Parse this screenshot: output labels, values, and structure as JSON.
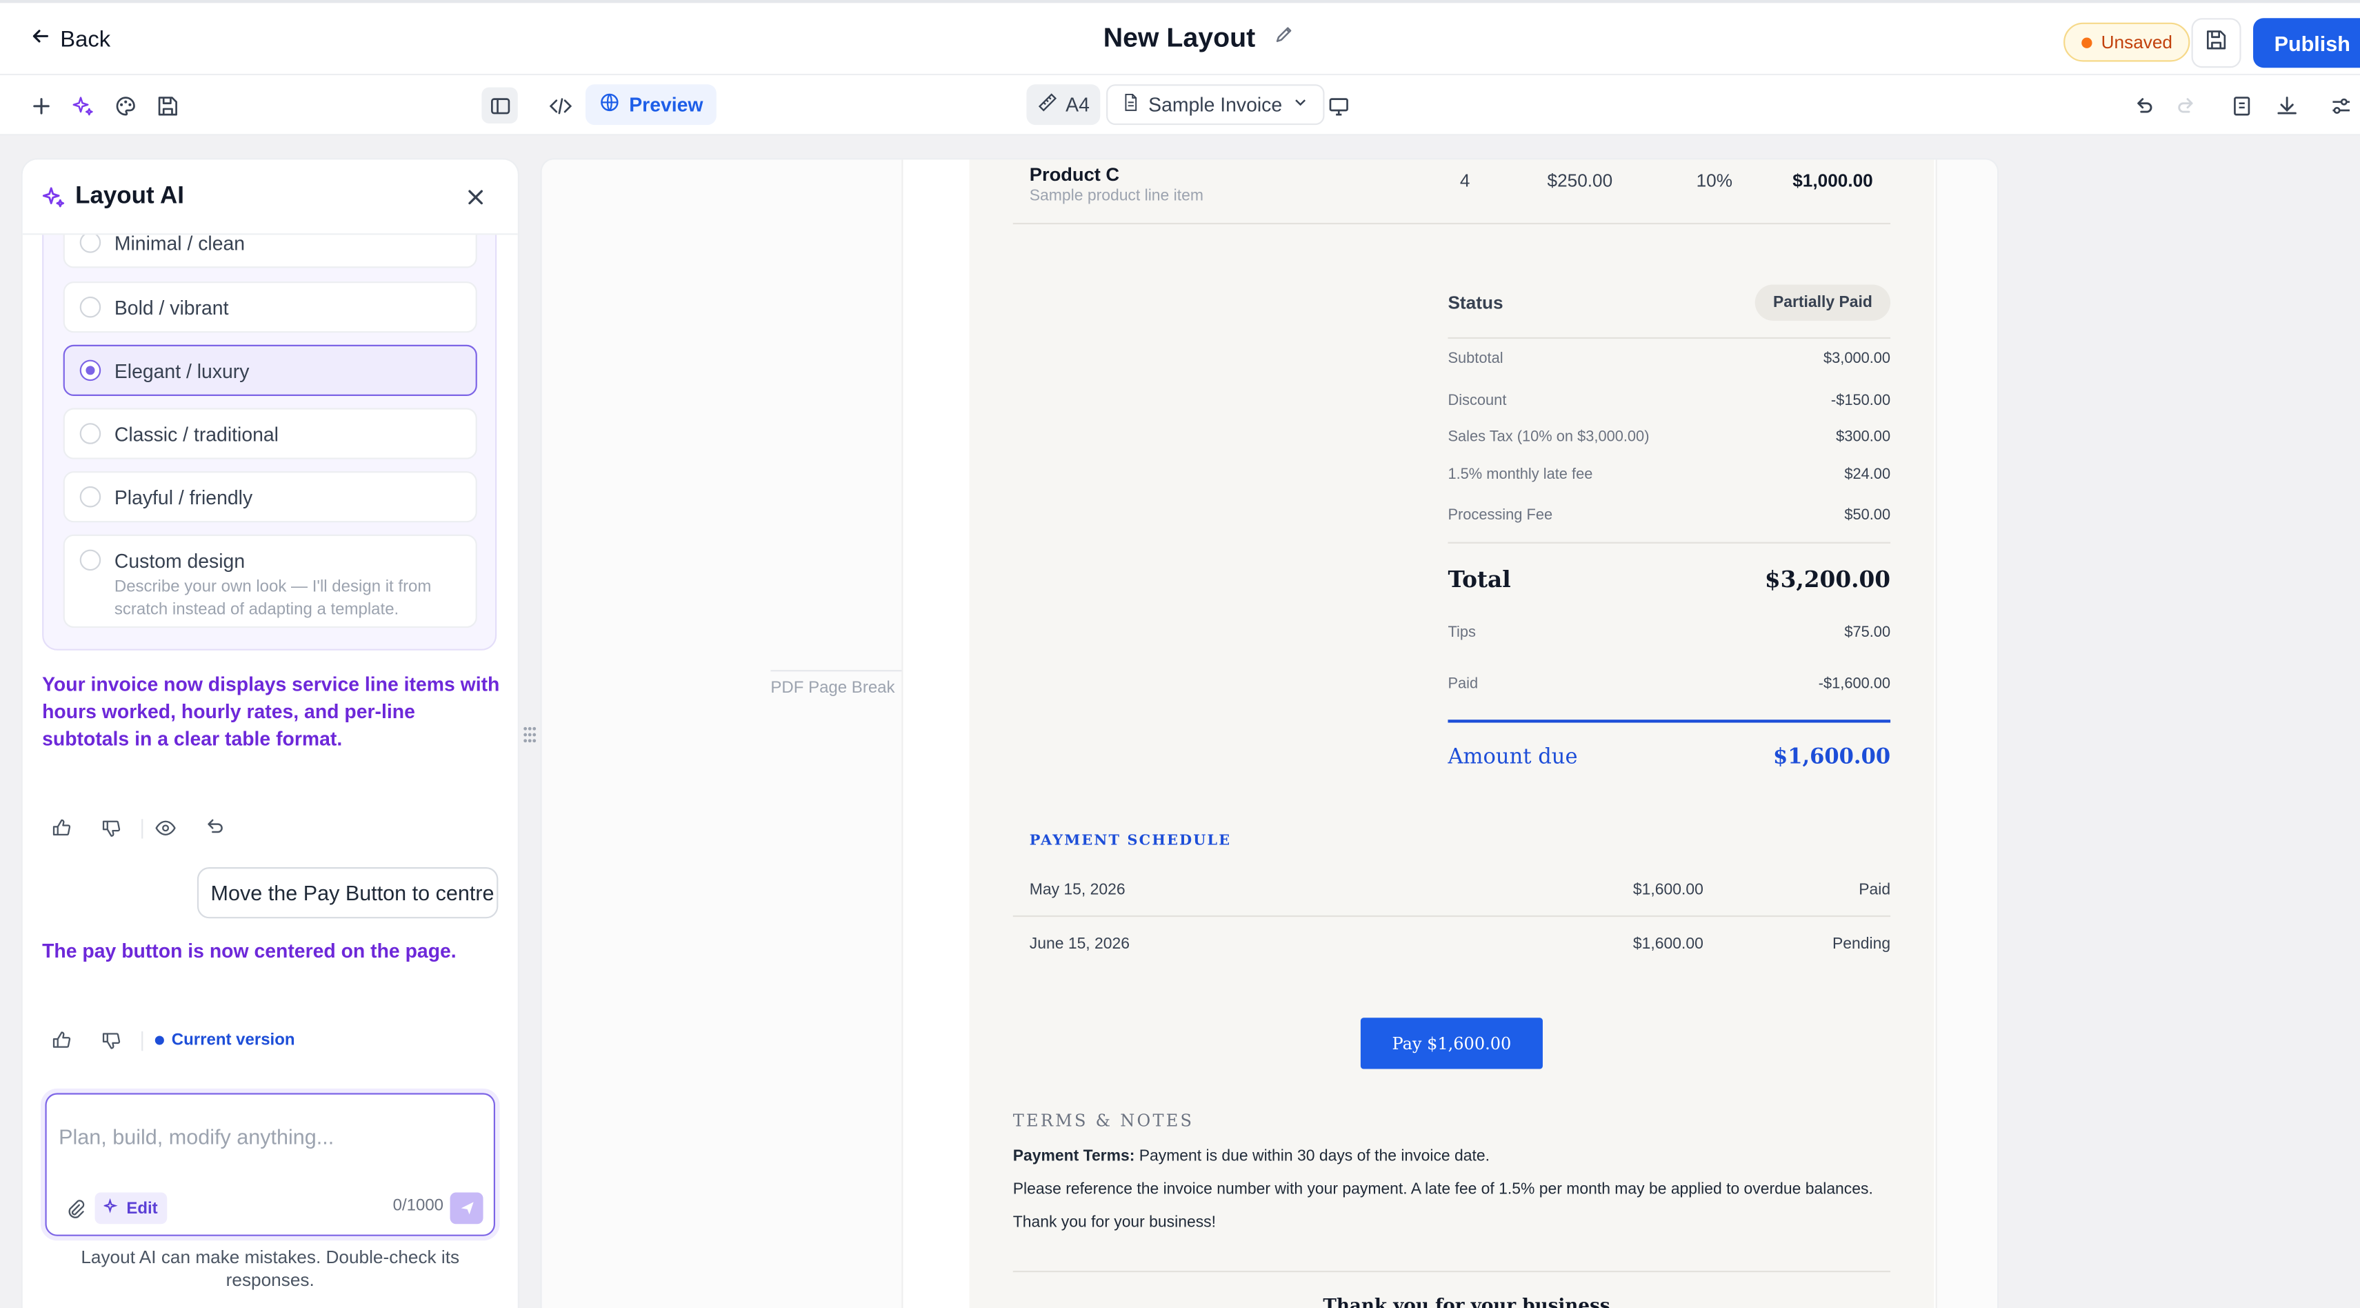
{
  "header": {
    "back_label": "Back",
    "title": "New Layout",
    "unsaved_label": "Unsaved",
    "publish_label": "Publish"
  },
  "toolbar": {
    "preview_label": "Preview",
    "paper_size": "A4",
    "sample_select": "Sample Invoice"
  },
  "panel": {
    "title": "Layout AI",
    "options": [
      {
        "label": "Minimal / clean",
        "selected": false
      },
      {
        "label": "Bold / vibrant",
        "selected": false
      },
      {
        "label": "Elegant / luxury",
        "selected": true
      },
      {
        "label": "Classic / traditional",
        "selected": false
      },
      {
        "label": "Playful / friendly",
        "selected": false
      },
      {
        "label": "Custom design",
        "selected": false,
        "description": "Describe your own look — I'll design it from scratch instead of adapting a template."
      }
    ],
    "ai_message_1": "Your invoice now displays service line items with hours worked, hourly rates, and per-line subtotals in a clear table format.",
    "user_message": "Move the Pay Button to centre",
    "ai_message_2": "The pay button is now centered on the page.",
    "current_version_label": "Current version",
    "input_placeholder": "Plan, build, modify anything...",
    "edit_label": "Edit",
    "char_counter": "0/1000",
    "disclaimer": "Layout AI can make mistakes. Double-check its responses."
  },
  "canvas": {
    "page_break_label": "PDF Page Break"
  },
  "invoice": {
    "line_item": {
      "name": "Product C",
      "desc": "Sample product line item",
      "qty": "4",
      "price": "$250.00",
      "tax": "10%",
      "total": "$1,000.00"
    },
    "status_label": "Status",
    "status_value": "Partially Paid",
    "summary": [
      {
        "label": "Subtotal",
        "value": "$3,000.00"
      },
      {
        "label": "Discount",
        "value": "-$150.00"
      },
      {
        "label": "Sales Tax (10% on $3,000.00)",
        "value": "$300.00"
      },
      {
        "label": "1.5% monthly late fee",
        "value": "$24.00"
      },
      {
        "label": "Processing Fee",
        "value": "$50.00"
      }
    ],
    "total_label": "Total",
    "total_value": "$3,200.00",
    "after_total": [
      {
        "label": "Tips",
        "value": "$75.00"
      },
      {
        "label": "Paid",
        "value": "-$1,600.00"
      }
    ],
    "amount_due_label": "Amount due",
    "amount_due_value": "$1,600.00",
    "schedule_title": "PAYMENT SCHEDULE",
    "schedule": [
      {
        "date": "May 15, 2026",
        "amount": "$1,600.00",
        "status": "Paid"
      },
      {
        "date": "June 15, 2026",
        "amount": "$1,600.00",
        "status": "Pending"
      }
    ],
    "pay_button": "Pay $1,600.00",
    "terms_title": "TERMS & NOTES",
    "terms_label": "Payment Terms:",
    "terms_text": " Payment is due within 30 days of the invoice date.",
    "terms_line2": "Please reference the invoice number with your payment. A late fee of 1.5% per month may be applied to overdue balances.",
    "terms_line3": "Thank you for your business!",
    "footer_thanks": "Thank you for your business"
  }
}
